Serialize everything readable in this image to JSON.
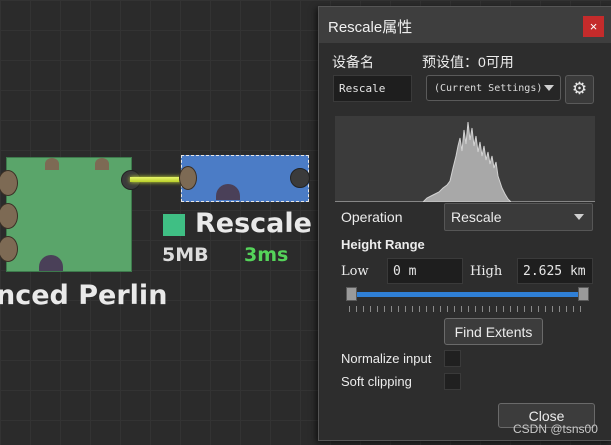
{
  "canvas": {
    "perlin_node": {
      "label": "nced Perlin"
    },
    "rescale_node": {
      "title": "Rescale",
      "size": "5MB",
      "time": "3ms"
    }
  },
  "panel": {
    "title": "Rescale属性",
    "close_glyph": "×",
    "device_name_label": "设备名",
    "device_name_value": "Rescale",
    "preset_label": "预设值：0可用",
    "preset_value": "(Current Settings)",
    "gear_icon": "gear-icon",
    "operation_label": "Operation",
    "operation_value": "Rescale",
    "height_range_label": "Height Range",
    "low_label": "Low",
    "low_value": "0 m",
    "high_label": "High",
    "high_value": "2.625 km",
    "find_extents_label": "Find Extents",
    "normalize_label": "Normalize input",
    "soft_clipping_label": "Soft clipping",
    "close_label": "Close",
    "slider": {
      "low_fraction": 0.0,
      "high_fraction": 1.0
    }
  },
  "colors": {
    "perlin_node": "#5aa56a",
    "rescale_node": "#4b7cc6",
    "time_green": "#55d35a",
    "slider_blue": "#2f7fd6",
    "close_red": "#c42b2b"
  },
  "watermark": "CSDN @tsns00"
}
